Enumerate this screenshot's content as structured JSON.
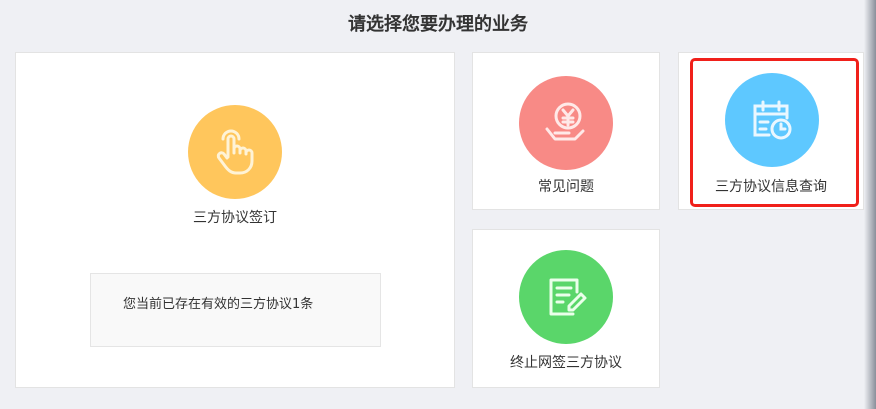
{
  "page": {
    "title": "请选择您要办理的业务"
  },
  "cards": [
    {
      "label": "三方协议签订",
      "icon": "hand-pointer-icon",
      "color": "#ffc65c"
    },
    {
      "label": "常见问题",
      "icon": "yuan-hand-icon",
      "color": "#f88a86"
    },
    {
      "label": "三方协议信息查询",
      "icon": "calendar-clock-icon",
      "color": "#5ec8ff"
    },
    {
      "label": "终止网签三方协议",
      "icon": "edit-document-icon",
      "color": "#5ad66a"
    }
  ],
  "info": {
    "text": "您当前已存在有效的三方协议1条"
  }
}
